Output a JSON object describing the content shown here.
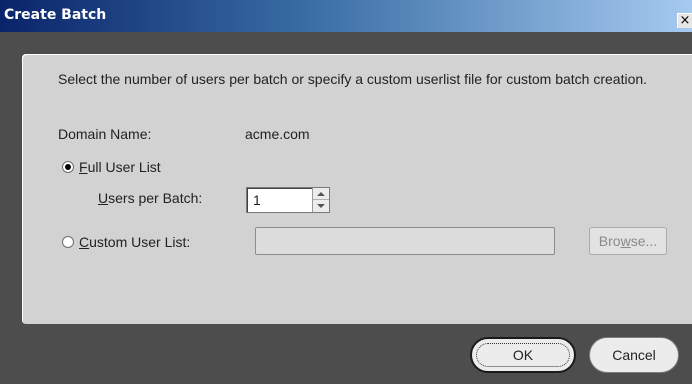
{
  "dialog": {
    "title": "Create Batch",
    "close_glyph": "×"
  },
  "content": {
    "description": "Select the number of users per batch or specify a custom userlist file for custom batch creation.",
    "domain_label": "Domain Name:",
    "domain_value": "acme.com",
    "full_user_list": {
      "mnemonic": "F",
      "rest": "ull User List",
      "checked": true
    },
    "users_per_batch": {
      "label_mnemonic": "U",
      "label_rest": "sers per Batch:",
      "value": "1"
    },
    "custom_user_list": {
      "mnemonic": "C",
      "rest": "ustom User List:",
      "checked": false,
      "value": ""
    },
    "browse": {
      "before": "Bro",
      "mnemonic": "w",
      "after": "se..."
    }
  },
  "buttons": {
    "ok": "OK",
    "cancel": "Cancel"
  },
  "colors": {
    "title_gradient_start": "#0a246a",
    "title_gradient_end": "#a6caf0",
    "panel_bg": "#d2d2d2",
    "window_bg": "#4d4d4d"
  },
  "icons": {
    "close": "close-icon",
    "spin_up": "chevron-up-icon",
    "spin_down": "chevron-down-icon"
  }
}
